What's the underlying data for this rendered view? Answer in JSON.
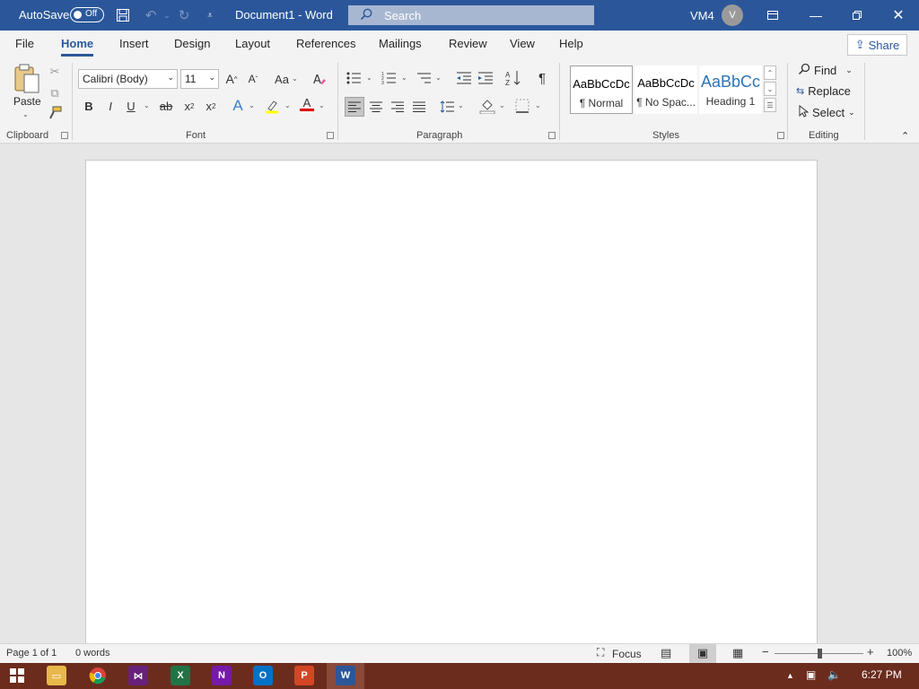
{
  "title_bar": {
    "autosave_label": "AutoSave",
    "autosave_state": "Off",
    "document_title": "Document1 - Word",
    "search_placeholder": "Search",
    "user_name": "VM4",
    "avatar_initial": "V",
    "brand_color": "#2b579a"
  },
  "tabs": [
    "File",
    "Home",
    "Insert",
    "Design",
    "Layout",
    "References",
    "Mailings",
    "Review",
    "View",
    "Help"
  ],
  "active_tab": "Home",
  "share_label": "Share",
  "ribbon": {
    "clipboard": {
      "paste_label": "Paste",
      "group_label": "Clipboard"
    },
    "font": {
      "font_name": "Calibri (Body)",
      "font_size": "11",
      "change_case": "Aa",
      "bold": "B",
      "italic": "I",
      "underline": "U",
      "strikethrough": "ab",
      "subscript": "x",
      "superscript": "x",
      "text_effects": "A",
      "font_color": "A",
      "group_label": "Font"
    },
    "paragraph": {
      "show_marks": "¶",
      "group_label": "Paragraph"
    },
    "styles": {
      "items": [
        {
          "sample": "AaBbCcDc",
          "name": "¶ Normal"
        },
        {
          "sample": "AaBbCcDc",
          "name": "¶ No Spac..."
        },
        {
          "sample": "AaBbCc",
          "name": "Heading 1"
        }
      ],
      "group_label": "Styles"
    },
    "editing": {
      "find": "Find",
      "replace": "Replace",
      "select": "Select",
      "group_label": "Editing"
    }
  },
  "status_bar": {
    "page": "Page 1 of 1",
    "words": "0 words",
    "focus": "Focus",
    "zoom": "100%",
    "zoom_level_percent": 100
  },
  "taskbar": {
    "clock": "6:27 PM",
    "apps": [
      "Start",
      "File Explorer",
      "Chrome",
      "Visual Studio",
      "Excel",
      "OneNote",
      "Outlook",
      "PowerPoint",
      "Word"
    ]
  }
}
